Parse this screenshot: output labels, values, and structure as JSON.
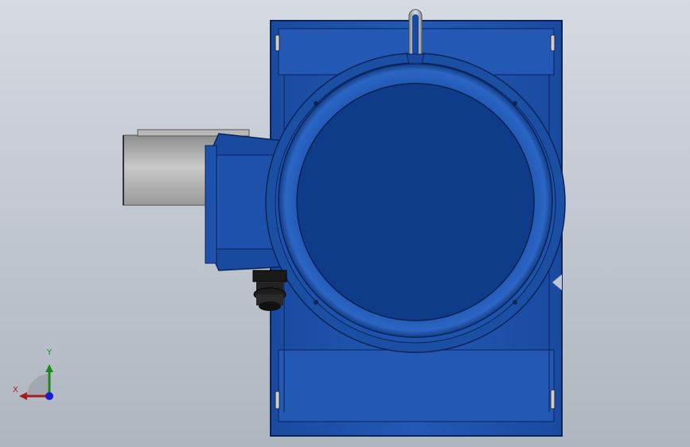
{
  "triad": {
    "x_label": "X",
    "y_label": "Y"
  },
  "colors": {
    "background_top": "#d6dae1",
    "background_bottom": "#aeb6c0",
    "body_blue": "#1b4fa3",
    "body_dark": "#0d3a85",
    "edge_dark": "#0a2458",
    "motor_gray": "#a9a9a9",
    "gland_black": "#111111",
    "axis_x": "#a02020",
    "axis_y": "#1a8a1a",
    "axis_z": "#1a1ad0"
  }
}
